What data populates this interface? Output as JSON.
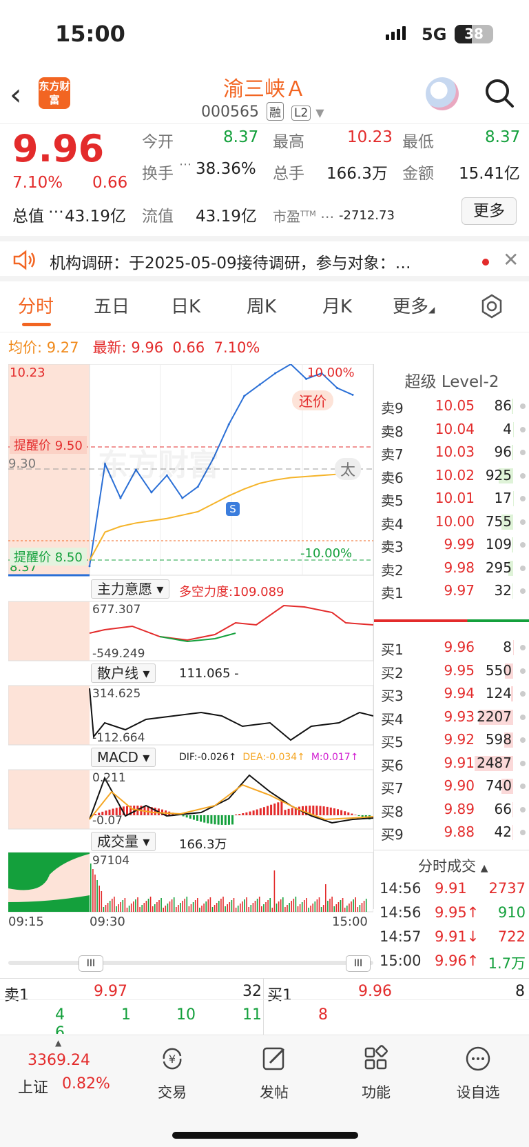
{
  "status_bar": {
    "time": "15:00",
    "network": "5G",
    "battery": "38"
  },
  "header": {
    "back_icon": "chevron-left-icon",
    "logo_text": "东方财富",
    "stock_name": "渝三峡Ａ",
    "stock_code": "000565",
    "tag_margin": "融",
    "tag_level": "L2",
    "assistant_icon": "robot-avatar-icon",
    "search_icon": "search-icon"
  },
  "quote": {
    "price": "9.96",
    "change_pct": "7.10%",
    "change": "0.66",
    "open_label": "今开",
    "open": "8.37",
    "high_label": "最高",
    "high": "10.23",
    "low_label": "最低",
    "low": "8.37",
    "turnover_label": "换手",
    "turnover": "38.36%",
    "volume_label": "总手",
    "volume": "166.3万",
    "amount_label": "金额",
    "amount": "15.41亿",
    "mktcap_label": "总值",
    "mktcap": "43.19亿",
    "float_label": "流值",
    "float": "43.19亿",
    "pe_label": "市盈",
    "pe_sup": "TTM",
    "pe": "-2712.73",
    "more_label": "更多"
  },
  "news": {
    "text": "机构调研：于2025-05-09接待调研，参与对象：…"
  },
  "tabs": [
    {
      "label": "分时"
    },
    {
      "label": "五日"
    },
    {
      "label": "日K"
    },
    {
      "label": "周K"
    },
    {
      "label": "月K"
    },
    {
      "label": "更多"
    }
  ],
  "summary": {
    "avg_label": "均价:",
    "avg": "9.27",
    "latest_label": "最新:",
    "latest": "9.96",
    "change": "0.66",
    "pct": "7.10%"
  },
  "chart": {
    "price_top": "10.23",
    "price_bottom": "8.37",
    "pct_top": "10.00%",
    "pct_bottom": "-10.00%",
    "alert_high": "提醒价 9.50",
    "alert_low": "提醒价 8.50",
    "pre_close": "9.30",
    "watermark": "东方财富",
    "repay_tag": "还价",
    "tai_tag": "太",
    "s_marker": "S",
    "panel1_select": "主力意愿",
    "panel1_value": "多空力度:109.089",
    "panel1_top": "677.307",
    "panel1_bottom": "-549.249",
    "panel2_select": "散户线",
    "panel2_value": "111.065 -",
    "panel2_top": "314.625",
    "panel2_bottom": "-112.664",
    "panel3_select": "MACD",
    "macd_dif": "DIF:-0.026↑",
    "macd_dea": "DEA:-0.034↑",
    "macd_m": "M:0.017↑",
    "panel3_top": "0.211",
    "panel3_bottom": "-0.07",
    "panel4_select": "成交量",
    "panel4_value": "166.3万",
    "panel4_top": "97104",
    "time_start": "09:15",
    "time_open": "09:30",
    "time_end": "15:00"
  },
  "chart_data": {
    "type": "line",
    "title": "",
    "x_range": [
      "09:30",
      "15:00"
    ],
    "ylim": [
      8.37,
      10.23
    ],
    "pre_close": 9.3,
    "series": [
      {
        "name": "",
        "values": [
          8.45,
          9.35,
          9.05,
          9.3,
          9.1,
          9.25,
          9.05,
          9.15,
          9.4,
          9.7,
          9.95,
          10.05,
          10.15,
          10.23,
          10.1,
          10.15,
          10.02,
          9.96
        ]
      },
      {
        "name": "",
        "values": [
          8.5,
          8.75,
          8.8,
          8.83,
          8.85,
          8.87,
          8.9,
          8.93,
          9.0,
          9.07,
          9.13,
          9.18,
          9.21,
          9.23,
          9.24,
          9.25,
          9.26,
          9.27
        ]
      }
    ]
  },
  "level2": {
    "title": "超级 Level-2",
    "asks": [
      {
        "label": "卖9",
        "price": "10.05",
        "vol": "86"
      },
      {
        "label": "卖8",
        "price": "10.04",
        "vol": "4"
      },
      {
        "label": "卖7",
        "price": "10.03",
        "vol": "96"
      },
      {
        "label": "卖6",
        "price": "10.02",
        "vol": "925"
      },
      {
        "label": "卖5",
        "price": "10.01",
        "vol": "17"
      },
      {
        "label": "卖4",
        "price": "10.00",
        "vol": "755"
      },
      {
        "label": "卖3",
        "price": "9.99",
        "vol": "109"
      },
      {
        "label": "卖2",
        "price": "9.98",
        "vol": "295"
      },
      {
        "label": "卖1",
        "price": "9.97",
        "vol": "32"
      }
    ],
    "bids": [
      {
        "label": "买1",
        "price": "9.96",
        "vol": "8"
      },
      {
        "label": "买2",
        "price": "9.95",
        "vol": "550"
      },
      {
        "label": "买3",
        "price": "9.94",
        "vol": "124"
      },
      {
        "label": "买4",
        "price": "9.93",
        "vol": "2207"
      },
      {
        "label": "买5",
        "price": "9.92",
        "vol": "598"
      },
      {
        "label": "买6",
        "price": "9.91",
        "vol": "2487"
      },
      {
        "label": "买7",
        "price": "9.90",
        "vol": "740"
      },
      {
        "label": "买8",
        "price": "9.89",
        "vol": "66"
      },
      {
        "label": "买9",
        "price": "9.88",
        "vol": "42"
      }
    ],
    "trades_title": "分时成交",
    "trades": [
      {
        "time": "14:56",
        "price": "9.91",
        "vol": "2737"
      },
      {
        "time": "14:56",
        "price": "9.95↑",
        "vol": "910"
      },
      {
        "time": "14:57",
        "price": "9.91↓",
        "vol": "722"
      },
      {
        "time": "15:00",
        "price": "9.96↑",
        "vol": "1.7万"
      }
    ]
  },
  "strip": {
    "ask_label": "卖1",
    "ask_price": "9.97",
    "ask_vol": "32",
    "bid_label": "买1",
    "bid_price": "9.96",
    "bid_vol": "8",
    "ask_queue": [
      "4",
      "1",
      "10",
      "11"
    ],
    "ask_queue_extra": "6",
    "bid_queue": [
      "8"
    ]
  },
  "bottom_nav": {
    "index_value": "3369.24",
    "index_name": "上证",
    "index_pct": "0.82%",
    "items": [
      {
        "label": "交易",
        "icon": "yen-refresh-icon"
      },
      {
        "label": "发帖",
        "icon": "edit-icon"
      },
      {
        "label": "功能",
        "icon": "grid-icon"
      },
      {
        "label": "设自选",
        "icon": "more-dots-icon"
      }
    ]
  }
}
